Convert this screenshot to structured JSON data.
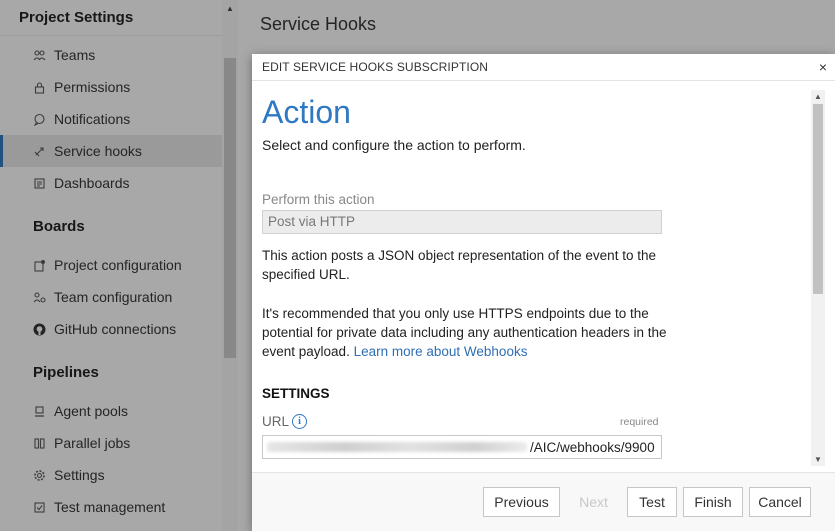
{
  "sidebar": {
    "title": "Project Settings",
    "general_items": [
      {
        "label": "Teams",
        "icon": "teams-icon"
      },
      {
        "label": "Permissions",
        "icon": "lock-icon"
      },
      {
        "label": "Notifications",
        "icon": "chat-icon"
      },
      {
        "label": "Service hooks",
        "icon": "hook-icon",
        "selected": true
      },
      {
        "label": "Dashboards",
        "icon": "dashboard-icon"
      }
    ],
    "boards": {
      "heading": "Boards",
      "items": [
        {
          "label": "Project configuration",
          "icon": "project-config-icon"
        },
        {
          "label": "Team configuration",
          "icon": "team-config-icon"
        },
        {
          "label": "GitHub connections",
          "icon": "github-icon"
        }
      ]
    },
    "pipelines": {
      "heading": "Pipelines",
      "items": [
        {
          "label": "Agent pools",
          "icon": "agent-pool-icon"
        },
        {
          "label": "Parallel jobs",
          "icon": "parallel-jobs-icon"
        },
        {
          "label": "Settings",
          "icon": "gear-icon"
        },
        {
          "label": "Test management",
          "icon": "test-icon"
        }
      ]
    }
  },
  "main": {
    "title": "Service Hooks"
  },
  "dialog": {
    "header": "EDIT SERVICE HOOKS SUBSCRIPTION",
    "close_glyph": "×",
    "title": "Action",
    "subtitle": "Select and configure the action to perform.",
    "perform_label": "Perform this action",
    "perform_value": "Post via HTTP",
    "description_1": "This action posts a JSON object representation of the event to the specified URL.",
    "description_2": "It's recommended that you only use HTTPS endpoints due to the potential for private data including any authentication headers in the event payload.",
    "learn_more_link": "Learn more about Webhooks",
    "settings_heading": "SETTINGS",
    "url_label": "URL",
    "url_required": "required",
    "url_visible_value": "/AIC/webhooks/9900"
  },
  "footer": {
    "previous": "Previous",
    "next": "Next",
    "test": "Test",
    "finish": "Finish",
    "cancel": "Cancel"
  },
  "colors": {
    "accent": "#2f78c4",
    "link": "#2f6fb5",
    "selected_indicator": "#2f6fb5"
  }
}
